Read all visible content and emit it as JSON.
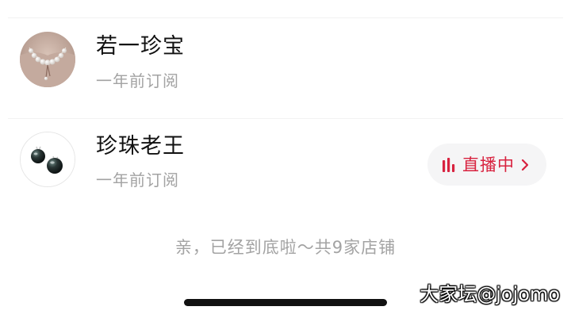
{
  "shops": [
    {
      "name": "若一珍宝",
      "subtitle": "一年前订阅",
      "avatar_icon": "pearl-necklace-image"
    },
    {
      "name": "珍珠老王",
      "subtitle": "一年前订阅",
      "avatar_icon": "black-pearl-earrings-image",
      "live_button": {
        "label": "直播中",
        "icon": "live-bars-icon",
        "accent_color": "#d8223f"
      }
    }
  ],
  "footer": {
    "end_text": "亲，已经到底啦～共9家店铺"
  },
  "watermark": "大家坛@jojomo"
}
